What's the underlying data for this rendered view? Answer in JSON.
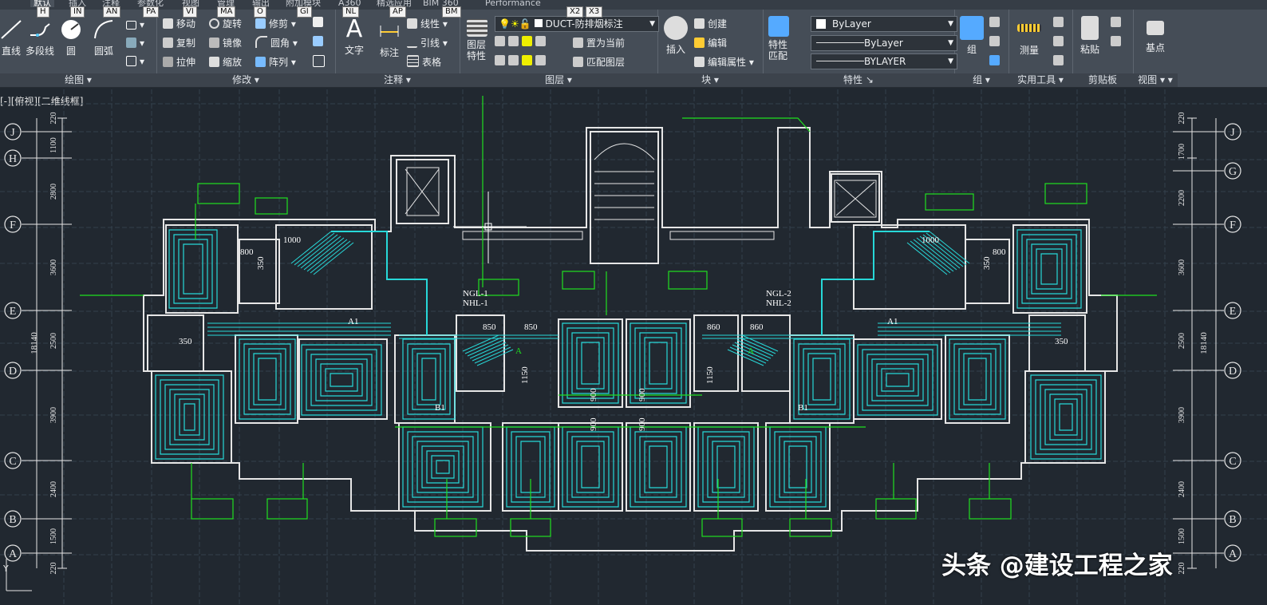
{
  "tabs": [
    "默认",
    "插入",
    "注释",
    "参数化",
    "视图",
    "管理",
    "输出",
    "附加模块",
    "A360",
    "精选应用",
    "BIM 360",
    "Performance"
  ],
  "keytips": [
    "H",
    "IN",
    "AN",
    "PA",
    "VI",
    "MA",
    "O",
    "GI",
    "NL",
    "AP",
    "BM",
    "X2",
    "X3"
  ],
  "panels": {
    "draw": {
      "title": "绘图",
      "line": "直线",
      "polyline": "多段线",
      "circle": "圆",
      "arc": "圆弧"
    },
    "modify": {
      "title": "修改",
      "move": "移动",
      "rotate": "旋转",
      "trim": "修剪",
      "copy": "复制",
      "mirror": "镜像",
      "fillet": "圆角",
      "stretch": "拉伸",
      "scale": "缩放",
      "array": "阵列"
    },
    "annotation": {
      "title": "注释",
      "text": "文字",
      "dimension": "标注",
      "linear": "线性",
      "leader": "引线",
      "table": "表格"
    },
    "layers": {
      "title": "图层",
      "props": "图层特性",
      "layer_name": "DUCT-防排烟标注",
      "set_current": "置为当前",
      "match": "匹配图层"
    },
    "block": {
      "title": "块",
      "insert": "插入",
      "create": "创建",
      "edit": "编辑",
      "edit_attr": "编辑属性"
    },
    "properties": {
      "title": "特性",
      "match_props": "特性匹配",
      "color": "ByLayer",
      "linetype": "ByLayer",
      "lineweight": "BYLAYER"
    },
    "groups": {
      "title": "组",
      "group": "组"
    },
    "utilities": {
      "title": "实用工具",
      "measure": "测量"
    },
    "clipboard": {
      "title": "剪贴板",
      "paste": "粘贴"
    },
    "view": {
      "title": "视图",
      "basepoint": "基点"
    }
  },
  "viewport_label": "[-][俯视][二维线框]",
  "grid_left": [
    "J",
    "H",
    "F",
    "E",
    "D",
    "C",
    "B",
    "A"
  ],
  "grid_right": [
    "J",
    "G",
    "F",
    "E",
    "D",
    "C",
    "B",
    "A"
  ],
  "dims_left": [
    "220",
    "1100",
    "2800",
    "3600",
    "2500",
    "3900",
    "2400",
    "1500",
    "220"
  ],
  "dims_right": [
    "220",
    "1700",
    "2200",
    "3600",
    "2500",
    "3900",
    "2400",
    "1500",
    "220"
  ],
  "total_dim": "18140",
  "drawing_labels": {
    "d1000": "1000",
    "d800": "800",
    "d350": "350",
    "d850": "850",
    "d860": "860",
    "d1150": "1150",
    "d900": "900",
    "ngl1": "NGL-1",
    "nhl1": "NHL-1",
    "ngl2": "NGL-2",
    "nhl2": "NHL-2",
    "a1": "A1",
    "b1": "B1",
    "a": "A"
  },
  "watermark": "头条 @建设工程之家",
  "colors": {
    "ribbon": "#454d57",
    "canvas": "#212830",
    "pipe": "#27d8d8",
    "green": "#1fe01f",
    "white": "#e6e6e6"
  }
}
